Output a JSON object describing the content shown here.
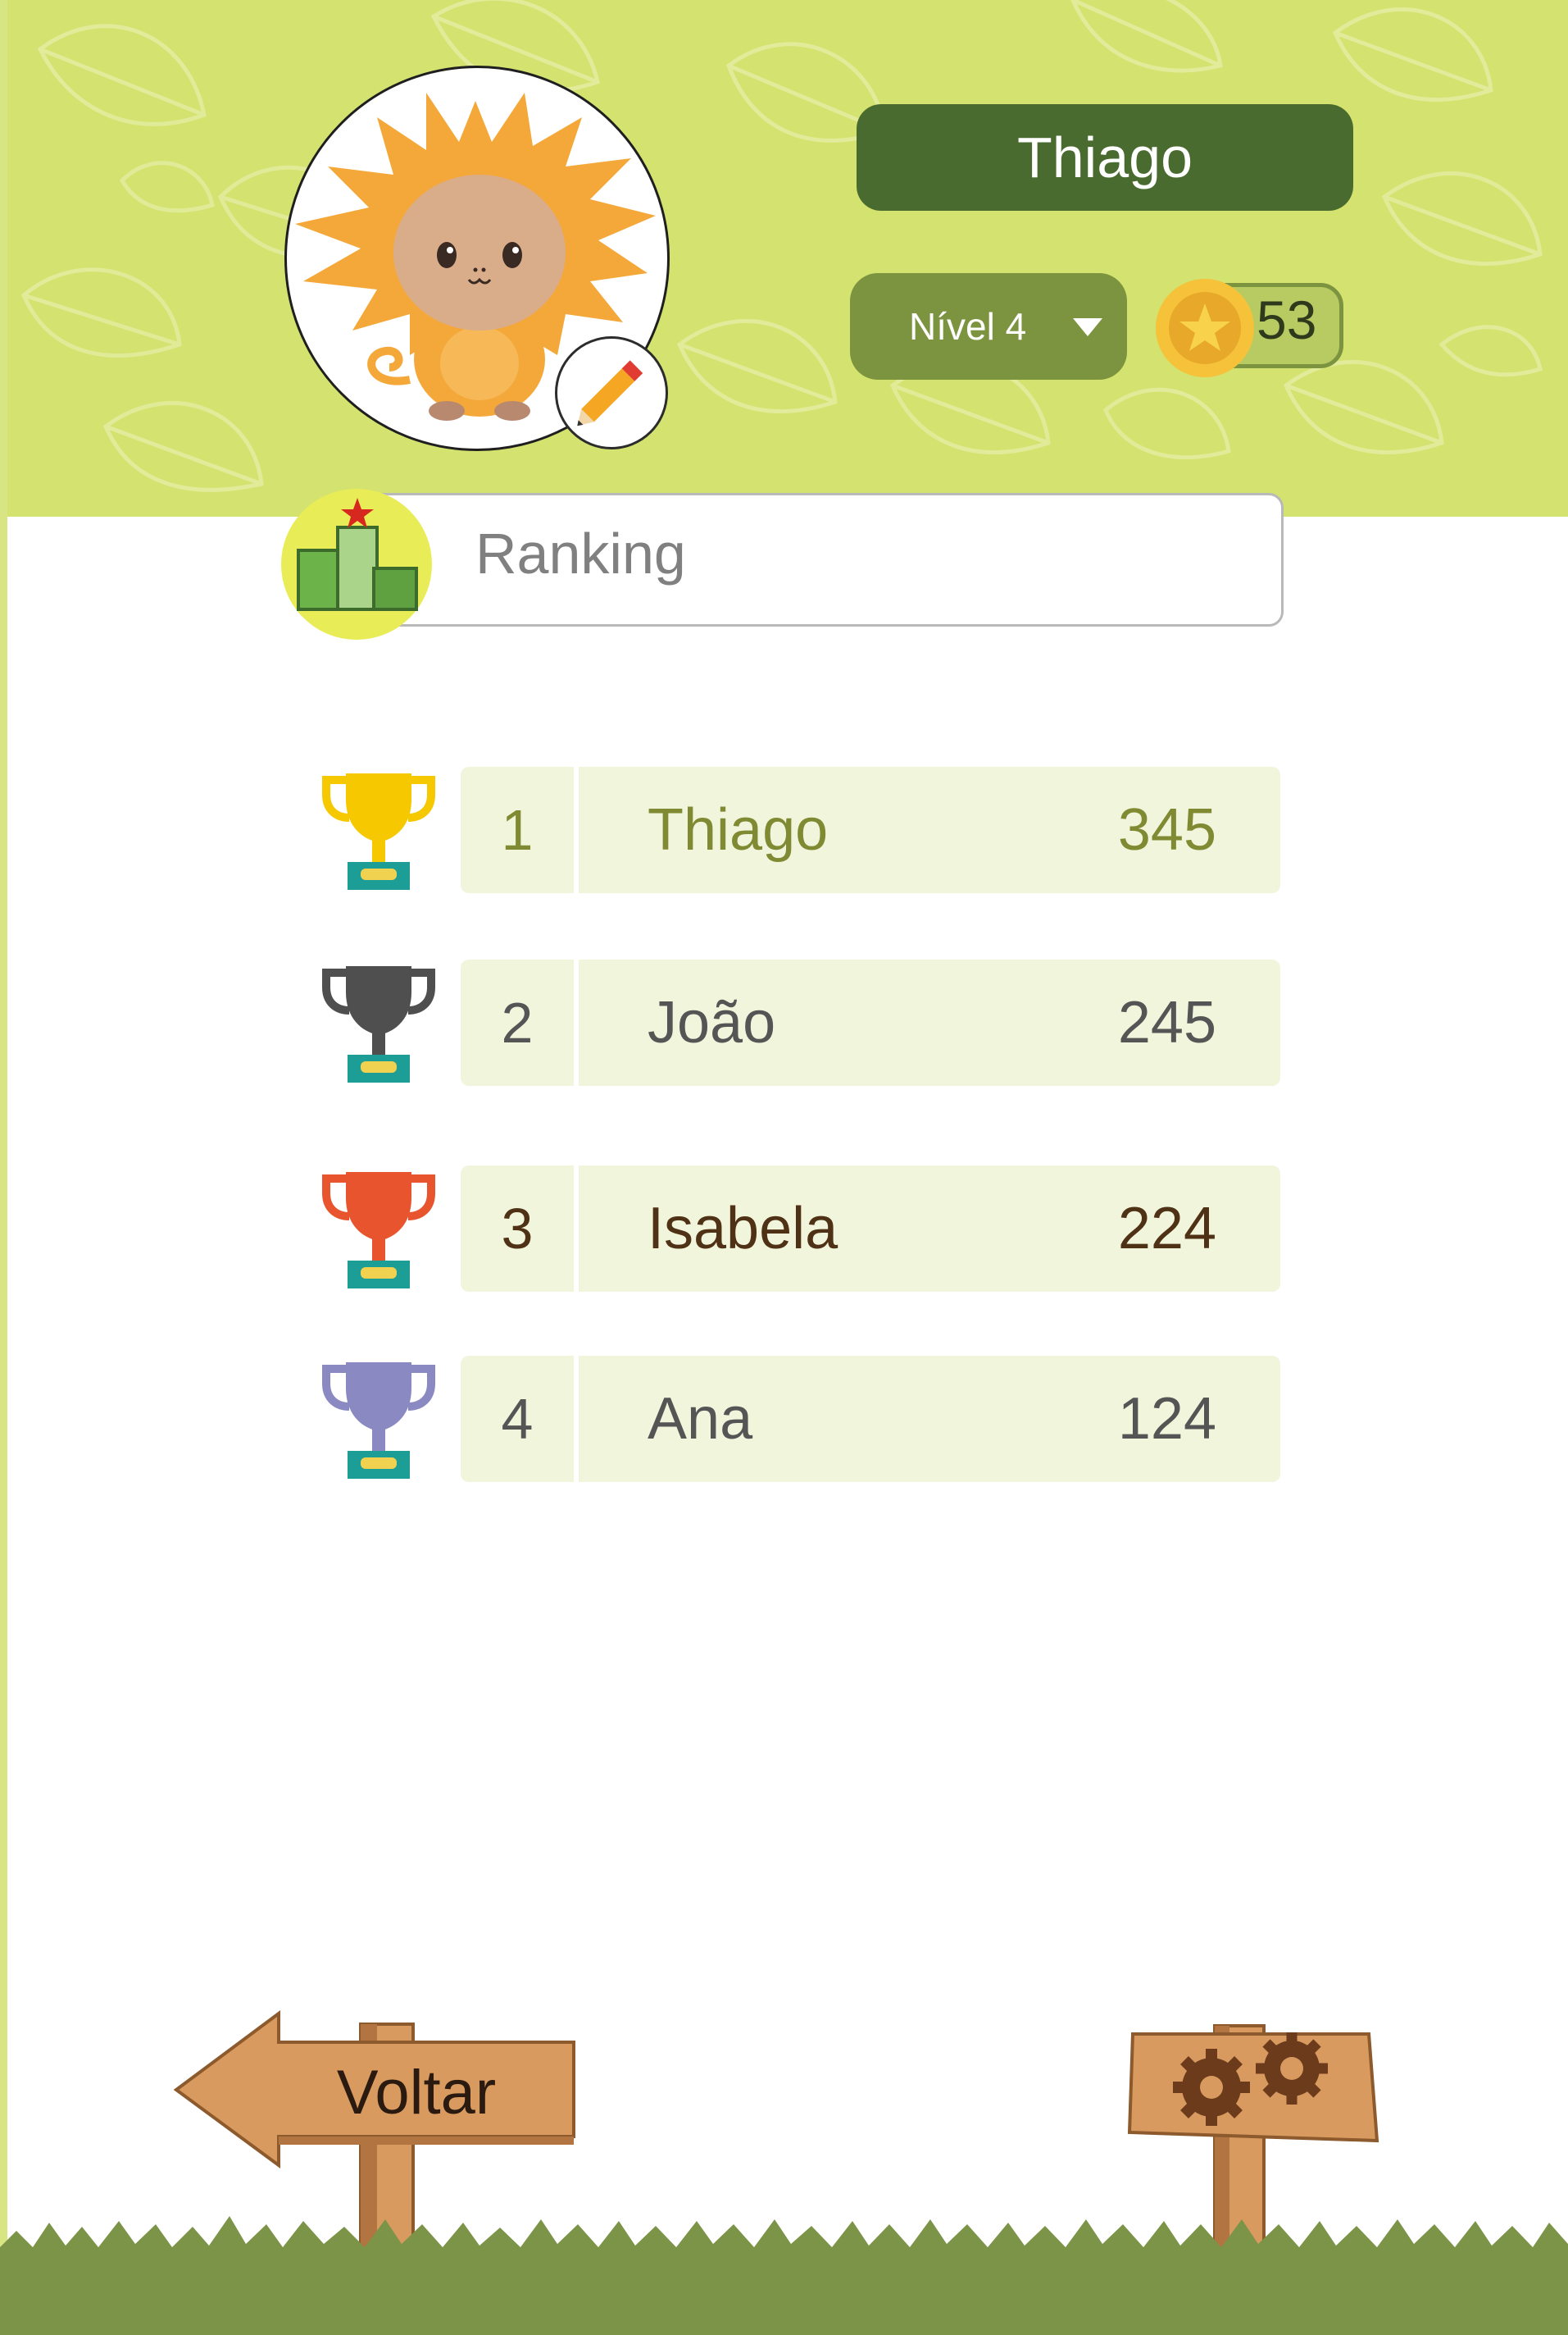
{
  "profile": {
    "name": "Thiago",
    "level_label": "Nível 4",
    "coins": "53"
  },
  "ranking": {
    "title": "Ranking",
    "rows": [
      {
        "position": "1",
        "name": "Thiago",
        "score": "345",
        "trophy": "gold-trophy",
        "trophy_color": "#f5c800",
        "text_color": "#7f8a33"
      },
      {
        "position": "2",
        "name": "João",
        "score": "245",
        "trophy": "silver-trophy",
        "trophy_color": "#4f4f4f",
        "text_color": "#555555"
      },
      {
        "position": "3",
        "name": "Isabela",
        "score": "224",
        "trophy": "bronze-trophy",
        "trophy_color": "#e8542e",
        "text_color": "#4f3216"
      },
      {
        "position": "4",
        "name": "Ana",
        "score": "124",
        "trophy": "purple-trophy",
        "trophy_color": "#8b89c2",
        "text_color": "#555555"
      }
    ]
  },
  "footer": {
    "back_label": "Voltar",
    "settings_icon": "gears-icon"
  },
  "colors": {
    "header_bg": "#d4e26f",
    "name_pill": "#4a6b2f",
    "level_pill": "#7c9440",
    "row_bg": "#f1f5dc",
    "grass": "#7b9448",
    "sign_wood": "#d89a5f"
  }
}
